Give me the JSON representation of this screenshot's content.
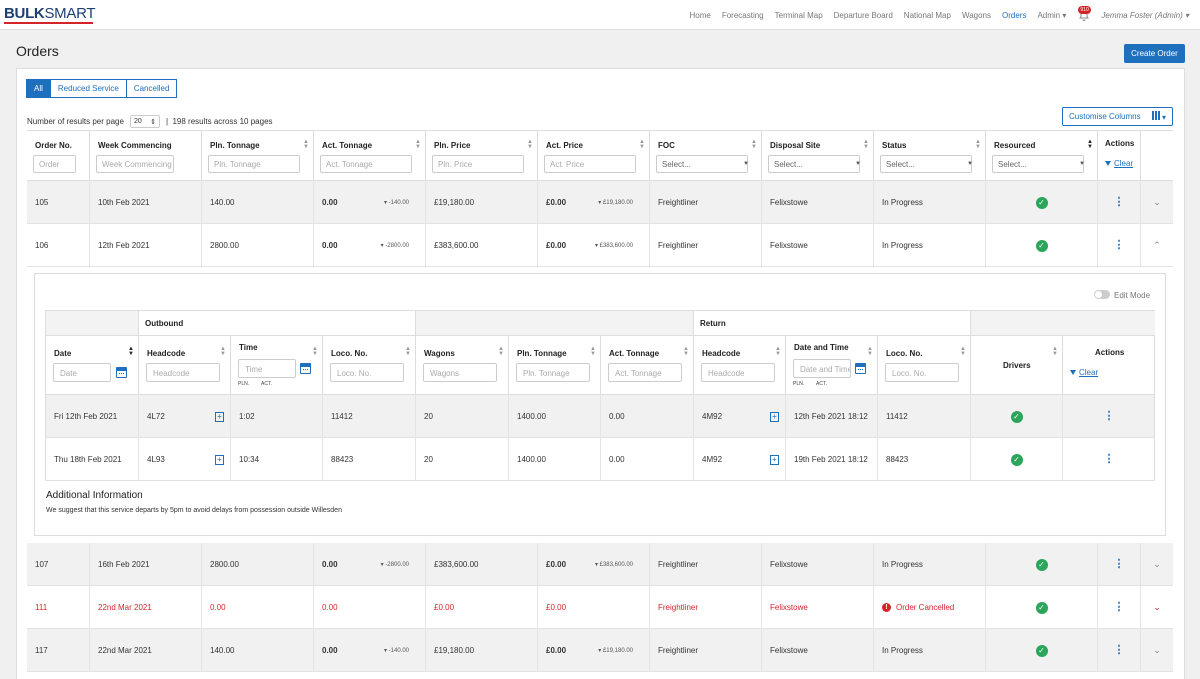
{
  "header": {
    "logo_bold": "BULK",
    "logo_rest": "SMART",
    "nav": [
      "Home",
      "Forecasting",
      "Terminal Map",
      "Departure Board",
      "National Map",
      "Wagons",
      "Orders",
      "Admin"
    ],
    "active": "Orders",
    "notif_count": "910",
    "user": "Jemma Foster (Admin)"
  },
  "page": {
    "title": "Orders",
    "create_button": "Create Order"
  },
  "filters": {
    "tabs": [
      "All",
      "Reduced Service",
      "Cancelled"
    ],
    "active_tab": "All"
  },
  "pagination": {
    "label": "Number of results per page",
    "per_page": "20",
    "summary": "198 results across 10 pages"
  },
  "customise": "Customise Columns",
  "columns": [
    {
      "label": "Order No.",
      "placeholder": "Order"
    },
    {
      "label": "Week Commencing",
      "placeholder": "Week Commencing"
    },
    {
      "label": "Pln. Tonnage",
      "placeholder": "Pln. Tonnage"
    },
    {
      "label": "Act. Tonnage",
      "placeholder": "Act. Tonnage"
    },
    {
      "label": "Pln. Price",
      "placeholder": "Pln. Price"
    },
    {
      "label": "Act. Price",
      "placeholder": "Act. Price"
    },
    {
      "label": "FOC",
      "placeholder": "Select..."
    },
    {
      "label": "Disposal Site",
      "placeholder": "Select..."
    },
    {
      "label": "Status",
      "placeholder": "Select..."
    },
    {
      "label": "Resourced",
      "placeholder": "Select..."
    },
    {
      "label": "Actions",
      "clear": "Clear"
    }
  ],
  "orders": [
    {
      "no": "105",
      "week": "10th Feb 2021",
      "pln_t": "140.00",
      "act_t": "0.00",
      "act_t_delta": "-140.00",
      "pln_p": "£19,180.00",
      "act_p": "£0.00",
      "act_p_delta": "£19,180.00",
      "foc": "Freightliner",
      "site": "Felixstowe",
      "status": "In Progress"
    },
    {
      "no": "106",
      "week": "12th Feb 2021",
      "pln_t": "2800.00",
      "act_t": "0.00",
      "act_t_delta": "-2800.00",
      "pln_p": "£383,600.00",
      "act_p": "£0.00",
      "act_p_delta": "£383,600.00",
      "foc": "Freightliner",
      "site": "Felixstowe",
      "status": "In Progress"
    },
    {
      "no": "107",
      "week": "16th Feb 2021",
      "pln_t": "2800.00",
      "act_t": "0.00",
      "act_t_delta": "-2800.00",
      "pln_p": "£383,600.00",
      "act_p": "£0.00",
      "act_p_delta": "£383,600.00",
      "foc": "Freightliner",
      "site": "Felixstowe",
      "status": "In Progress"
    },
    {
      "no": "111",
      "week": "22nd Mar 2021",
      "pln_t": "0.00",
      "act_t": "0.00",
      "act_t_delta": "",
      "pln_p": "£0.00",
      "act_p": "£0.00",
      "act_p_delta": "",
      "foc": "Freightliner",
      "site": "Felixstowe",
      "status": "Order Cancelled"
    },
    {
      "no": "117",
      "week": "22nd Mar 2021",
      "pln_t": "140.00",
      "act_t": "0.00",
      "act_t_delta": "-140.00",
      "pln_p": "£19,180.00",
      "act_p": "£0.00",
      "act_p_delta": "£19,180.00",
      "foc": "Freightliner",
      "site": "Felixstowe",
      "status": "In Progress"
    }
  ],
  "detail": {
    "edit_mode": "Edit Mode",
    "groups": {
      "outbound": "Outbound",
      "return": "Return"
    },
    "columns": [
      {
        "label": "Date",
        "placeholder": "Date"
      },
      {
        "label": "Headcode",
        "placeholder": "Headcode"
      },
      {
        "label": "Time",
        "placeholder": "Time"
      },
      {
        "label": "Loco. No.",
        "placeholder": "Loco. No."
      },
      {
        "label": "Wagons",
        "placeholder": "Wagons"
      },
      {
        "label": "Pln. Tonnage",
        "placeholder": "Pln. Tonnage"
      },
      {
        "label": "Act. Tonnage",
        "placeholder": "Act. Tonnage"
      },
      {
        "label": "Headcode",
        "placeholder": "Headcode"
      },
      {
        "label": "Date and Time",
        "placeholder": "Date and Time"
      },
      {
        "label": "Loco. No.",
        "placeholder": "Loco. No."
      },
      {
        "label": "Drivers"
      },
      {
        "label": "Actions",
        "clear": "Clear"
      }
    ],
    "pln": "PLN.",
    "act": "ACT.",
    "rows": [
      {
        "date": "Fri 12th Feb 2021",
        "hc": "4L72",
        "time": "1:02",
        "loco": "11412",
        "wagons": "20",
        "pln_t": "1400.00",
        "act_t": "0.00",
        "r_hc": "4M92",
        "r_dt": "12th Feb 2021 18:12",
        "r_loco": "11412"
      },
      {
        "date": "Thu 18th Feb 2021",
        "hc": "4L93",
        "time": "10:34",
        "loco": "88423",
        "wagons": "20",
        "pln_t": "1400.00",
        "act_t": "0.00",
        "r_hc": "4M92",
        "r_dt": "19th Feb 2021 18:12",
        "r_loco": "88423"
      }
    ],
    "additional_title": "Additional Information",
    "additional_text": "We suggest that this service departs by 5pm to avoid delays from possession outside Willesden"
  },
  "colors": {
    "primary": "#1f6fbf",
    "danger": "#d4242b",
    "success": "#2aa55a"
  },
  "icons": [
    "calendar-icon",
    "check-icon",
    "kebab-icon",
    "chevron-down-icon",
    "chevron-up-icon",
    "filter-icon",
    "bell-icon",
    "columns-icon",
    "plus-icon",
    "sort-icon",
    "error-icon"
  ]
}
